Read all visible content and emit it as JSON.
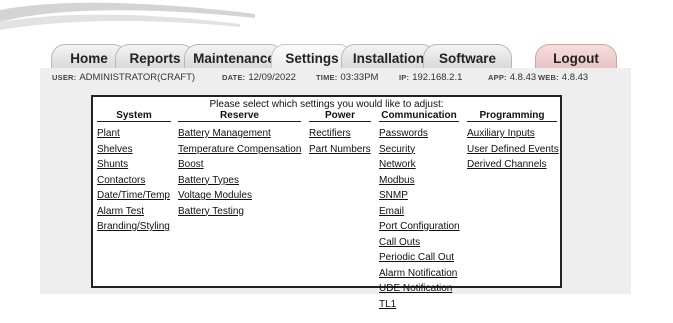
{
  "tabs": [
    {
      "label": "Home"
    },
    {
      "label": "Reports"
    },
    {
      "label": "Maintenance"
    },
    {
      "label": "Settings"
    },
    {
      "label": "Installation"
    },
    {
      "label": "Software"
    },
    {
      "label": "Logout"
    }
  ],
  "status": {
    "user_label": "USER:",
    "user_value": "ADMINISTRATOR(CRAFT)",
    "date_label": "DATE:",
    "date_value": "12/09/2022",
    "time_label": "TIME:",
    "time_value": "03:33PM",
    "ip_label": "IP:",
    "ip_value": "192.168.2.1",
    "app_label": "APP:",
    "app_value": "4.8.43",
    "web_label": "WEB:",
    "web_value": "4.8.43"
  },
  "settings_panel": {
    "prompt": "Please select which settings you would like to adjust:",
    "columns": [
      {
        "header": "System",
        "links": [
          "Plant",
          "Shelves",
          "Shunts",
          "Contactors",
          "Date/Time/Temp",
          "Alarm Test",
          "Branding/Styling"
        ]
      },
      {
        "header": "Reserve",
        "links": [
          "Battery Management",
          "Temperature Compensation",
          "Boost",
          "Battery Types",
          "Voltage Modules",
          "Battery Testing"
        ]
      },
      {
        "header": "Power",
        "links": [
          "Rectifiers",
          "Part Numbers"
        ]
      },
      {
        "header": "Communication",
        "links": [
          "Passwords",
          "Security",
          "Network",
          "Modbus",
          "SNMP",
          "Email",
          "Port Configuration",
          "Call Outs",
          "Periodic Call Out",
          "Alarm Notification",
          "UDE Notification",
          "TL1"
        ]
      },
      {
        "header": "Programming",
        "links": [
          "Auxiliary Inputs",
          "User Defined Events",
          "Derived Channels"
        ]
      }
    ]
  },
  "colors": {
    "background": "#ffffff",
    "status_bar": "#eeeeee",
    "panel_border": "#222222",
    "logout_tab": "#e9c3c3",
    "swoosh": "#c9c9c9"
  }
}
